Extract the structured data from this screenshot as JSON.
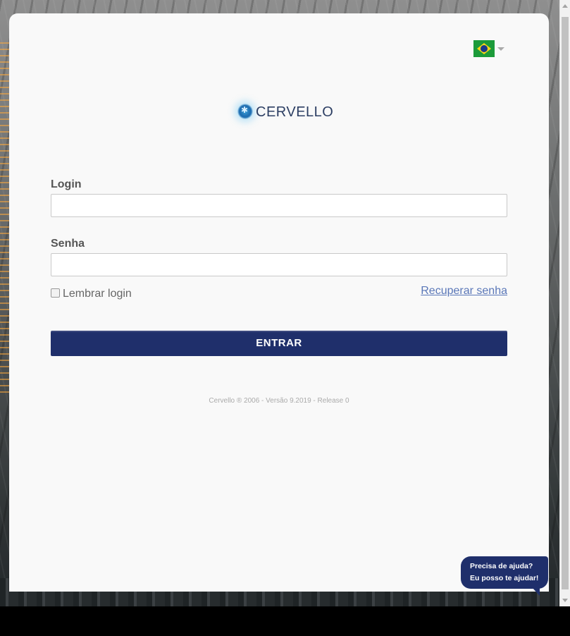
{
  "language": {
    "flag": "flag-brazil-icon"
  },
  "brand": {
    "name": "CERVELLO"
  },
  "form": {
    "login_label": "Login",
    "login_value": "",
    "password_label": "Senha",
    "password_value": "",
    "remember_label": "Lembrar login",
    "recover_label": "Recuperar senha",
    "submit_label": "ENTRAR"
  },
  "footer": {
    "text": "Cervello ® 2006 - Versão 9.2019 - Release 0"
  },
  "help_bubble": {
    "line1": "Precisa de ajuda?",
    "line2": "Eu posso te ajudar!"
  },
  "colors": {
    "primary": "#1f2f6b",
    "link": "#5a77b8",
    "card_bg": "#f9f9f9"
  }
}
